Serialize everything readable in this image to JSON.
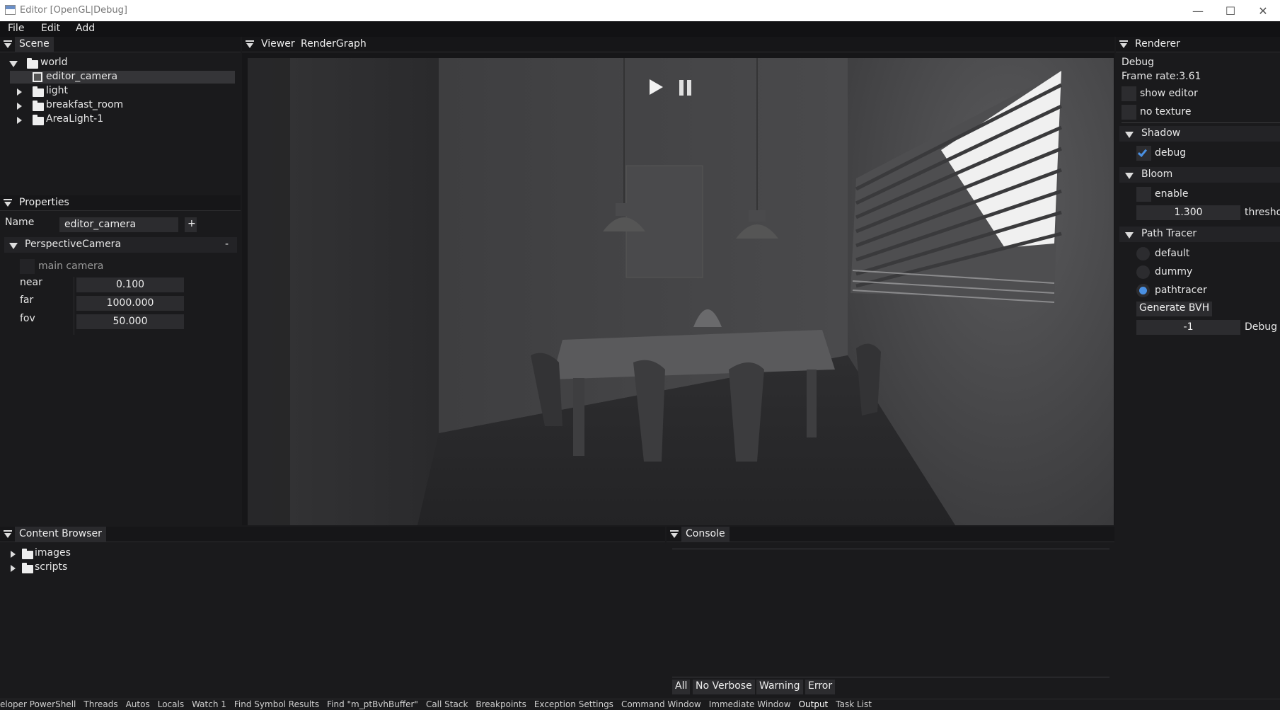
{
  "window": {
    "title": "Editor [OpenGL|Debug]",
    "minimize_icon": "minimize-icon",
    "maximize_icon": "maximize-icon",
    "close_icon": "close-icon"
  },
  "menu": {
    "file": "File",
    "edit": "Edit",
    "add": "Add"
  },
  "scene": {
    "title": "Scene",
    "tree": {
      "world": "world",
      "editor_camera": "editor_camera",
      "light": "light",
      "breakfast_room": "breakfast_room",
      "arealight": "AreaLight-1"
    }
  },
  "properties": {
    "title": "Properties",
    "name_label": "Name",
    "name_value": "editor_camera",
    "add_button": "+",
    "component": "PerspectiveCamera",
    "remove_button": "-",
    "main_camera": "main camera",
    "near_label": "near",
    "near_value": "0.100",
    "far_label": "far",
    "far_value": "1000.000",
    "fov_label": "fov",
    "fov_value": "50.000"
  },
  "viewer": {
    "tab_viewer": "Viewer",
    "tab_rendergraph": "RenderGraph"
  },
  "renderer": {
    "title": "Renderer",
    "mode": "Debug",
    "frame_rate": "Frame rate:3.61",
    "show_editor": "show editor",
    "no_texture": "no texture",
    "shadow": {
      "title": "Shadow",
      "debug": "debug",
      "debug_checked": true
    },
    "bloom": {
      "title": "Bloom",
      "enable": "enable",
      "threshold_value": "1.300",
      "threshold_label": "thresho"
    },
    "path_tracer": {
      "title": "Path Tracer",
      "default": "default",
      "dummy": "dummy",
      "pathtracer": "pathtracer",
      "selected": "pathtracer",
      "generate": "Generate BVH",
      "debug_value": "-1",
      "debug_label": "Debug I"
    }
  },
  "content": {
    "title": "Content Browser",
    "images": "images",
    "scripts": "scripts"
  },
  "console": {
    "title": "Console",
    "filters": {
      "all": "All",
      "no_verbose": "No Verbose",
      "warning": "Warning",
      "error": "Error"
    }
  },
  "statusbar": {
    "items": [
      "eloper PowerShell",
      "Threads",
      "Autos",
      "Locals",
      "Watch 1",
      "Find Symbol Results",
      "Find \"m_ptBvhBuffer\"",
      "Call Stack",
      "Breakpoints",
      "Exception Settings",
      "Command Window",
      "Immediate Window",
      "Output",
      "Task List"
    ]
  },
  "colors": {
    "accent": "#4a90e2",
    "panel_bg": "#1a1a1c",
    "field_bg": "#2c2c2f"
  }
}
